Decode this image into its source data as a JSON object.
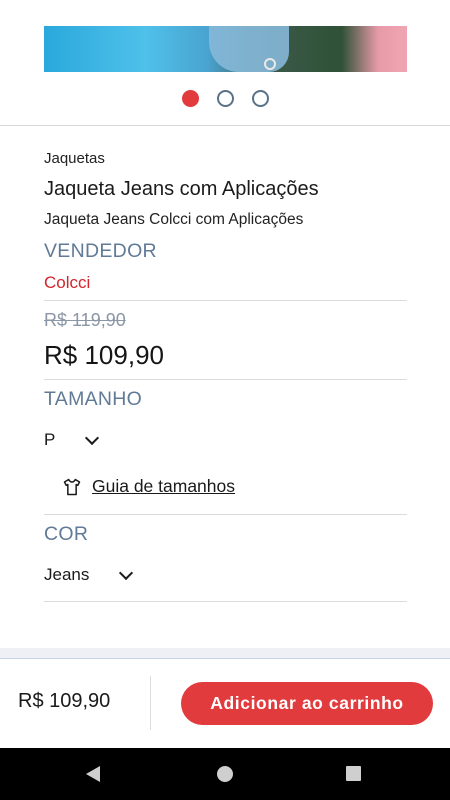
{
  "carousel": {
    "dots": [
      {
        "active": true
      },
      {
        "active": false
      },
      {
        "active": false
      }
    ],
    "active_color": "#e23b3e"
  },
  "product": {
    "category": "Jaquetas",
    "name": "Jaqueta Jeans com Aplicações",
    "description": "Jaqueta Jeans Colcci com Aplicações",
    "vendor_label": "VENDEDOR",
    "vendor": "Colcci",
    "old_price": "R$ 119,90",
    "price": "R$ 109,90"
  },
  "size": {
    "label": "TAMANHO",
    "selected": "P",
    "guide_label": "Guia de tamanhos",
    "guide_icon": "shirt-icon"
  },
  "color": {
    "label": "COR",
    "selected": "Jeans"
  },
  "footer": {
    "price": "R$ 109,90",
    "add_to_cart_label": "Adicionar ao carrinho"
  },
  "theme": {
    "accent": "#e23b3e",
    "section_label": "#617a96",
    "vendor_color": "#d0262c"
  },
  "system_nav": {
    "back_icon": "back-triangle-icon",
    "home_icon": "home-circle-icon",
    "recents_icon": "recents-square-icon"
  }
}
